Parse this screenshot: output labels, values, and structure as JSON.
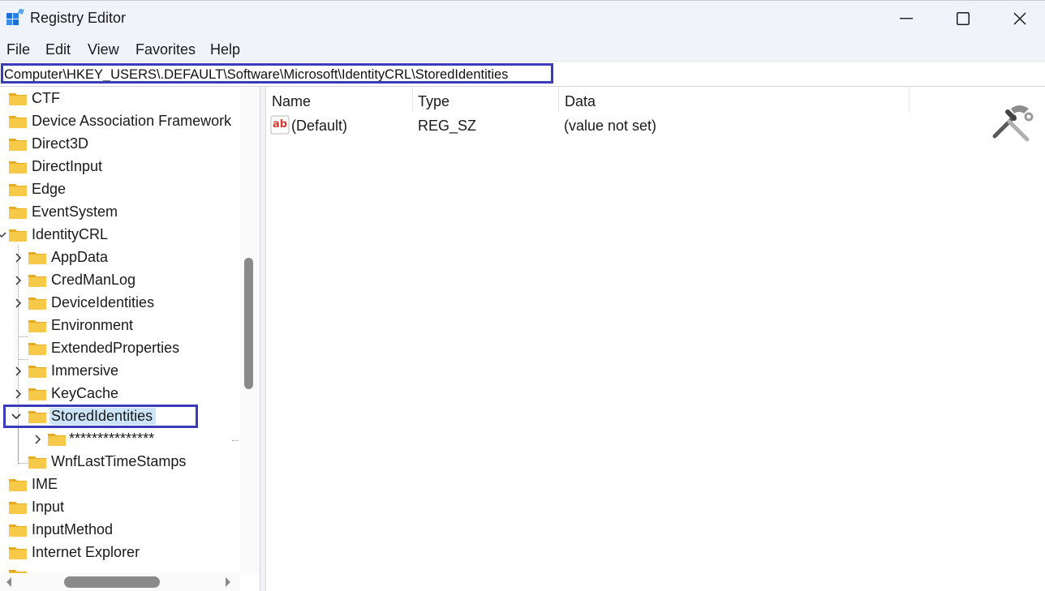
{
  "window": {
    "title": "Registry Editor",
    "controls": [
      "minimize",
      "maximize",
      "close"
    ]
  },
  "menu": [
    "File",
    "Edit",
    "View",
    "Favorites",
    "Help"
  ],
  "address": {
    "path": "Computer\\HKEY_USERS\\.DEFAULT\\Software\\Microsoft\\IdentityCRL\\StoredIdentities"
  },
  "tree": {
    "items": [
      {
        "label": "CTF",
        "level": 1,
        "expandable": false
      },
      {
        "label": "Device Association Framework",
        "level": 1,
        "expandable": false
      },
      {
        "label": "Direct3D",
        "level": 1,
        "expandable": false
      },
      {
        "label": "DirectInput",
        "level": 1,
        "expandable": false
      },
      {
        "label": "Edge",
        "level": 1,
        "expandable": false
      },
      {
        "label": "EventSystem",
        "level": 1,
        "expandable": false
      },
      {
        "label": "IdentityCRL",
        "level": 1,
        "expandable": true,
        "expanded": true
      },
      {
        "label": "AppData",
        "level": 2,
        "expandable": true
      },
      {
        "label": "CredManLog",
        "level": 2,
        "expandable": true
      },
      {
        "label": "DeviceIdentities",
        "level": 2,
        "expandable": true
      },
      {
        "label": "Environment",
        "level": 2,
        "expandable": false
      },
      {
        "label": "ExtendedProperties",
        "level": 2,
        "expandable": false
      },
      {
        "label": "Immersive",
        "level": 2,
        "expandable": true
      },
      {
        "label": "KeyCache",
        "level": 2,
        "expandable": true
      },
      {
        "label": "StoredIdentities",
        "level": 2,
        "expandable": true,
        "expanded": true,
        "selected": true
      },
      {
        "label": "***************",
        "level": 3,
        "expandable": true
      },
      {
        "label": "WnfLastTimeStamps",
        "level": 2,
        "expandable": false
      },
      {
        "label": "IME",
        "level": 1,
        "expandable": false
      },
      {
        "label": "Input",
        "level": 1,
        "expandable": false
      },
      {
        "label": "InputMethod",
        "level": 1,
        "expandable": false
      },
      {
        "label": "Internet Explorer",
        "level": 1,
        "expandable": false
      }
    ]
  },
  "values_list": {
    "columns": [
      "Name",
      "Type",
      "Data"
    ],
    "rows": [
      {
        "name": "(Default)",
        "type": "REG_SZ",
        "data": "(value not set)",
        "icon": "string-value-ab-icon"
      }
    ]
  },
  "colors": {
    "highlight_border": "#3a3bb8",
    "selection": "#cce4f7",
    "folder": "#f7c948",
    "chrome": "#f0f3f9"
  }
}
